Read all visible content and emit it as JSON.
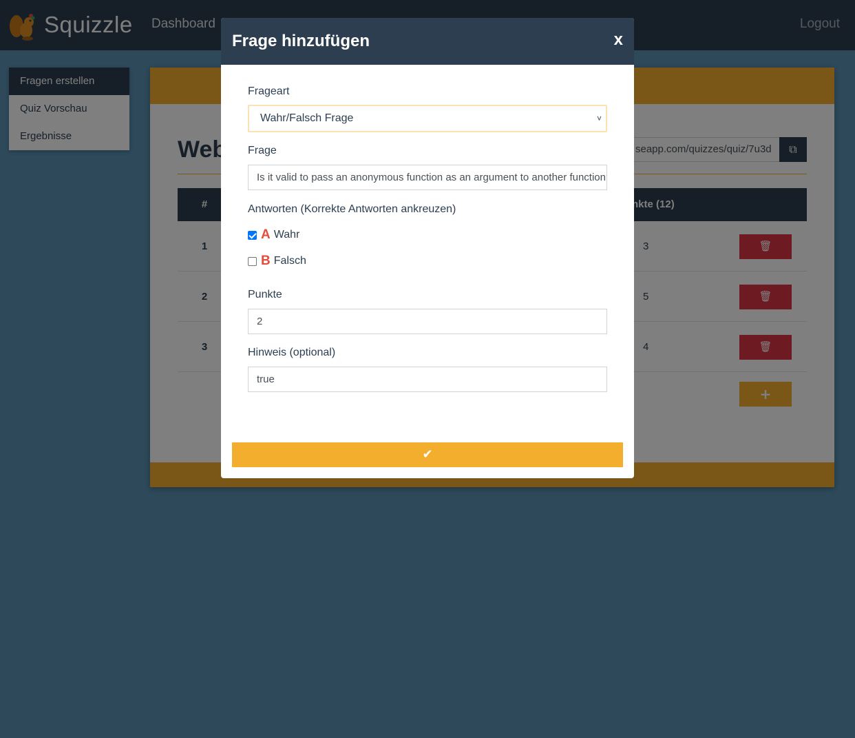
{
  "navbar": {
    "brand": "Squizzle",
    "dashboard_label": "Dashboard",
    "logout_label": "Logout"
  },
  "sidebar": {
    "items": [
      {
        "label": "Fragen erstellen",
        "active": true
      },
      {
        "label": "Quiz Vorschau",
        "active": false
      },
      {
        "label": "Ergebnisse",
        "active": false
      }
    ]
  },
  "quiz": {
    "title_partial": "Web",
    "share_link_visible": "seapp.com/quizzes/quiz/7u3d",
    "table": {
      "col_number": "#",
      "col_points_partial": "nkte (12)",
      "rows": [
        {
          "number": "1",
          "points": "3"
        },
        {
          "number": "2",
          "points": "5"
        },
        {
          "number": "3",
          "points": "4"
        }
      ]
    }
  },
  "modal": {
    "title": "Frage hinzufügen",
    "close_label": "x",
    "question_type_label": "Frageart",
    "question_type_value": "Wahr/Falsch Frage",
    "question_label": "Frage",
    "question_value": "Is it valid to pass an anonymous function as an argument to another function?",
    "answers_label": "Antworten (Korrekte Antworten ankreuzen)",
    "answers": [
      {
        "letter": "A",
        "text": "Wahr",
        "checked": true
      },
      {
        "letter": "B",
        "text": "Falsch",
        "checked": false
      }
    ],
    "points_label": "Punkte",
    "points_value": "2",
    "hint_label": "Hinweis (optional)",
    "hint_value": "true"
  },
  "colors": {
    "navy": "#2c3e50",
    "accent": "#f4ae2e",
    "danger": "#dc3545",
    "letter_red": "#e74c3c"
  }
}
